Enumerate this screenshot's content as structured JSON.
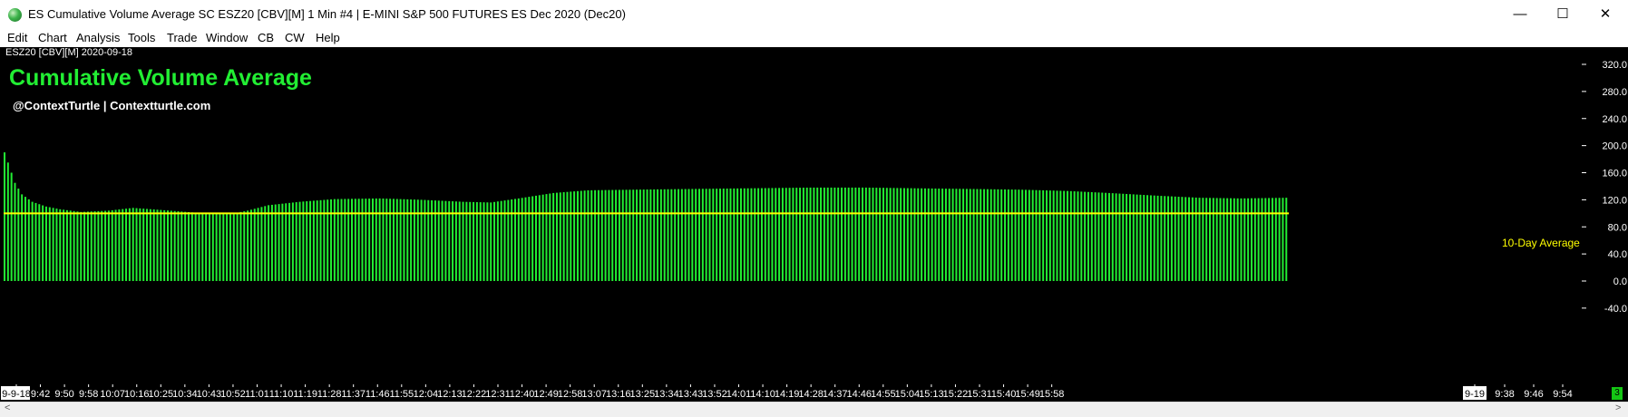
{
  "window": {
    "title": "ES Cumulative Volume Average  SC ESZ20 [CBV][M]  1 Min   #4 | E-MINI S&P 500 FUTURES ES Dec 2020 (Dec20)",
    "minimize_glyph": "—",
    "maximize_glyph": "☐",
    "close_glyph": "✕"
  },
  "menu": [
    "Edit",
    "Chart",
    "Analysis",
    "Tools",
    "Trade",
    "Window",
    "CB",
    "CW",
    "Help"
  ],
  "chart_header": {
    "symbol_label": "ESZ20 [CBV][M] 2020-09-18",
    "subtitle": "@ContextTurtle | Contextturtle.com"
  },
  "status": {
    "badge": "3"
  },
  "scroll": {
    "left_glyph": "<",
    "right_glyph": ">"
  },
  "colors": {
    "background": "#000000",
    "bars": "#22ee33",
    "average_line": "#ffff00",
    "axis_text": "#ffffff",
    "title_text": "#22ee33"
  },
  "chart_data": {
    "type": "bar",
    "title": "Cumulative Volume Average",
    "series": [
      {
        "name": "10-Day Average",
        "type": "line",
        "value": 100
      }
    ],
    "ylim": [
      -60,
      340
    ],
    "yticks": [
      320,
      280,
      240,
      200,
      160,
      120,
      80,
      40,
      0,
      -40
    ],
    "ytick_labels": [
      "320.0",
      "280.0",
      "240.0",
      "200.0",
      "160.0",
      "120.0",
      "80.0",
      "40.0",
      "0.0",
      "-40.0"
    ],
    "x_ticks_today": [
      "9-9-18",
      "9:42",
      "9:50",
      "9:58",
      "10:07",
      "10:16",
      "10:25",
      "10:34",
      "10:43",
      "10:52",
      "11:01",
      "11:10",
      "11:19",
      "11:28",
      "11:37",
      "11:46",
      "11:55",
      "12:04",
      "12:13",
      "12:22",
      "12:31",
      "12:40",
      "12:49",
      "12:58",
      "13:07",
      "13:16",
      "13:25",
      "13:34",
      "13:43",
      "13:52",
      "14:01",
      "14:10",
      "14:19",
      "14:28",
      "14:37",
      "14:46",
      "14:55",
      "15:04",
      "15:13",
      "15:22",
      "15:31",
      "15:40",
      "15:49",
      "15:58"
    ],
    "x_ticks_next": [
      "9-19",
      "9:38",
      "9:46",
      "9:54"
    ],
    "bar_count": 370,
    "keypoints": [
      [
        0,
        190
      ],
      [
        1,
        175
      ],
      [
        2,
        160
      ],
      [
        3,
        145
      ],
      [
        5,
        128
      ],
      [
        8,
        117
      ],
      [
        12,
        110
      ],
      [
        16,
        106
      ],
      [
        22,
        102
      ],
      [
        30,
        104
      ],
      [
        37,
        108
      ],
      [
        45,
        105
      ],
      [
        55,
        101
      ],
      [
        60,
        100
      ],
      [
        66,
        100
      ],
      [
        70,
        104
      ],
      [
        76,
        112
      ],
      [
        85,
        117
      ],
      [
        95,
        121
      ],
      [
        108,
        122
      ],
      [
        120,
        120
      ],
      [
        132,
        117
      ],
      [
        140,
        116
      ],
      [
        148,
        122
      ],
      [
        158,
        130
      ],
      [
        168,
        134
      ],
      [
        182,
        135
      ],
      [
        198,
        136
      ],
      [
        215,
        137
      ],
      [
        232,
        138
      ],
      [
        248,
        138
      ],
      [
        262,
        137
      ],
      [
        278,
        136
      ],
      [
        292,
        135
      ],
      [
        306,
        133
      ],
      [
        318,
        130
      ],
      [
        332,
        126
      ],
      [
        344,
        123
      ],
      [
        356,
        122
      ],
      [
        369,
        123
      ]
    ]
  }
}
